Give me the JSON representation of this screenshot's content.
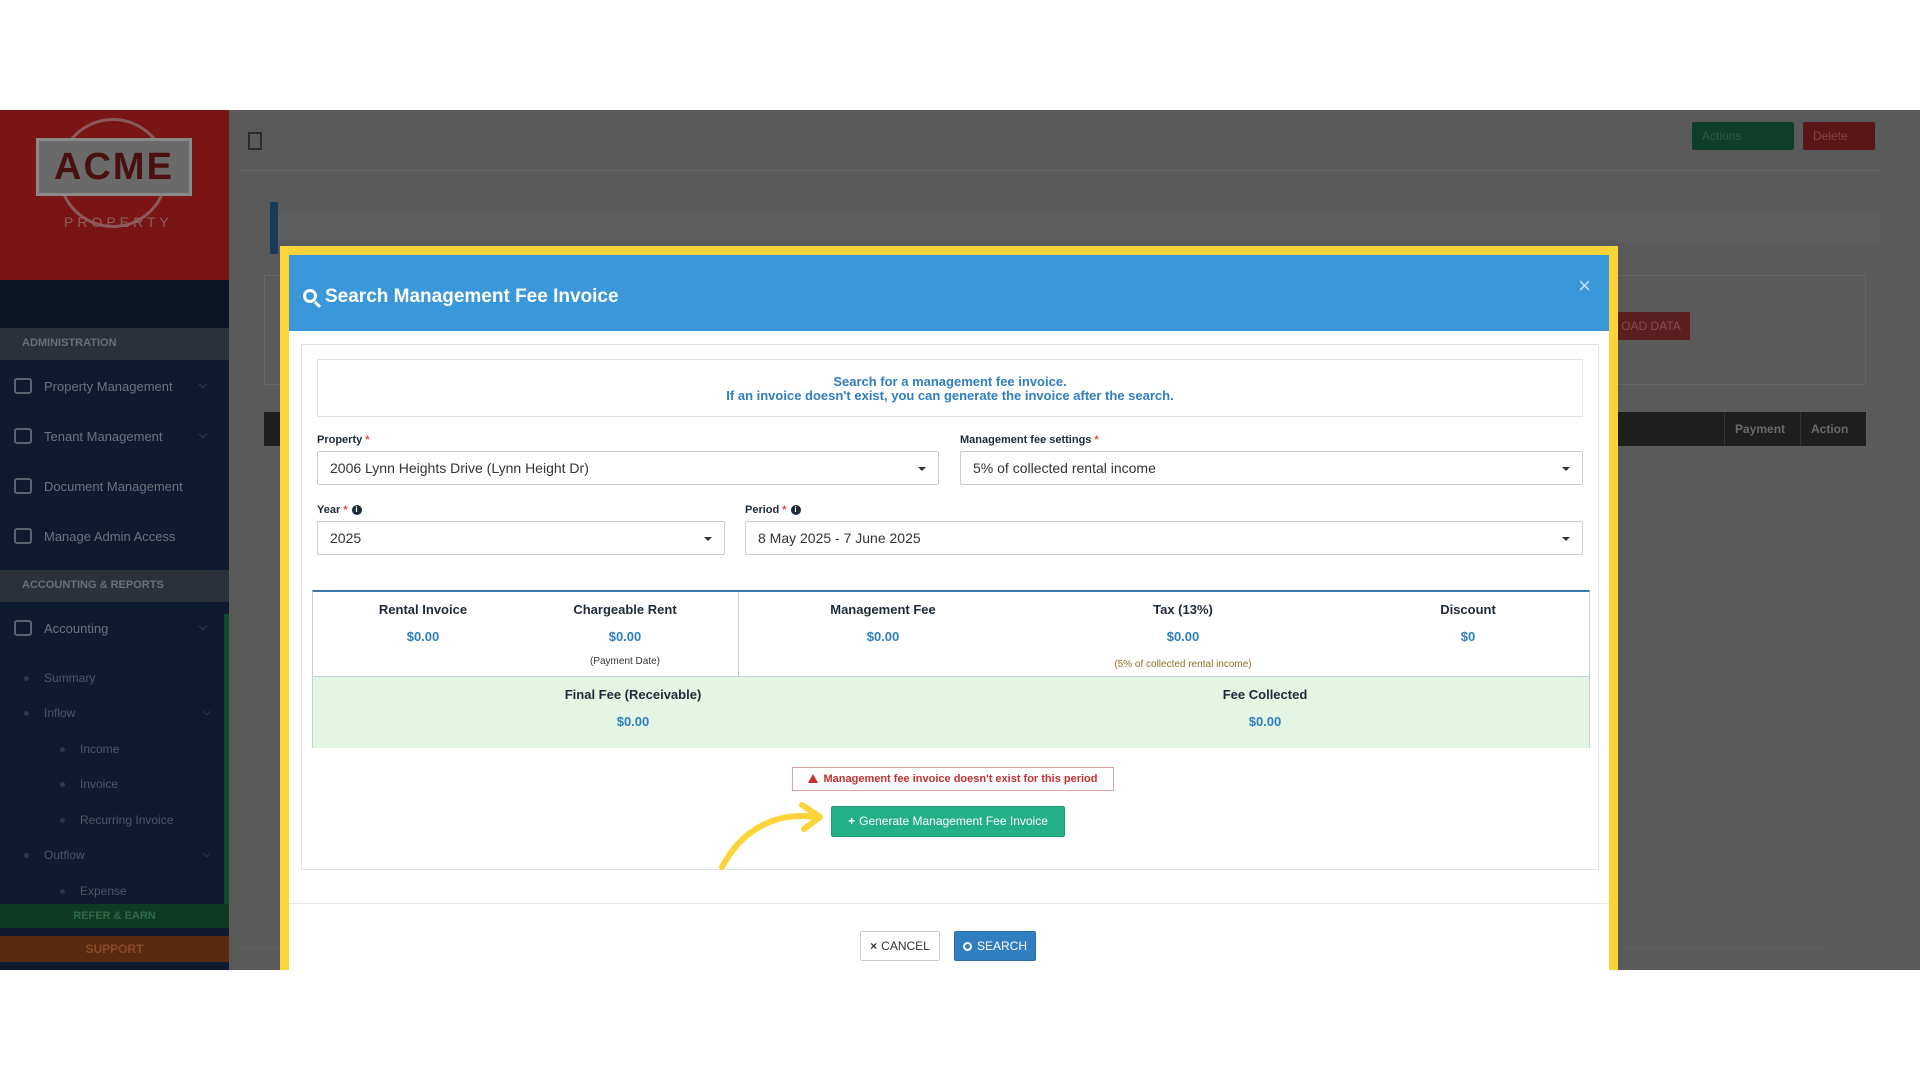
{
  "logo": {
    "brand": "ACME",
    "sub": "PROPERTY"
  },
  "sidebar": {
    "sections": [
      "ADMINISTRATION",
      "ACCOUNTING & REPORTS"
    ],
    "admin_items": [
      {
        "label": "Property Management"
      },
      {
        "label": "Tenant Management"
      },
      {
        "label": "Document Management"
      },
      {
        "label": "Manage Admin Access"
      }
    ],
    "accounting": {
      "label": "Accounting"
    },
    "sub_items": {
      "summary": "Summary",
      "inflow": "Inflow",
      "income": "Income",
      "invoice": "Invoice",
      "recurring": "Recurring Invoice",
      "outflow": "Outflow",
      "expense": "Expense"
    },
    "refer": "REFER & EARN",
    "support": "SUPPORT"
  },
  "background": {
    "actions_label": "Actions",
    "delete_label": "Delete",
    "load_label": "OAD DATA",
    "table_headers": {
      "payment": "Payment",
      "action": "Action"
    }
  },
  "modal": {
    "title": "Search Management Fee Invoice",
    "info_line1": "Search for a management fee invoice.",
    "info_line2": "If an invoice doesn't exist, you can generate the invoice after the search.",
    "fields": {
      "property": {
        "label": "Property",
        "value": "2006 Lynn Heights Drive (Lynn Height Dr)"
      },
      "fee_settings": {
        "label": "Management fee settings",
        "value": "5% of collected rental income"
      },
      "year": {
        "label": "Year",
        "value": "2025"
      },
      "period": {
        "label": "Period",
        "value": "8 May 2025 - 7 June 2025"
      }
    },
    "summary": {
      "rental_invoice": {
        "label": "Rental Invoice",
        "value": "$0.00"
      },
      "chargeable_rent": {
        "label": "Chargeable Rent",
        "value": "$0.00",
        "note": "(Payment Date)"
      },
      "management_fee": {
        "label": "Management Fee",
        "value": "$0.00"
      },
      "tax": {
        "label": "Tax (13%)",
        "value": "$0.00"
      },
      "discount": {
        "label": "Discount",
        "value": "$0"
      },
      "fee_note": "(5% of collected rental income)",
      "final_fee": {
        "label": "Final Fee (Receivable)",
        "value": "$0.00"
      },
      "fee_collected": {
        "label": "Fee Collected",
        "value": "$0.00"
      }
    },
    "alert": "Management fee invoice doesn't exist for this period",
    "generate_label": "Generate Management Fee Invoice",
    "cancel_label": "CANCEL",
    "search_label": "SEARCH"
  },
  "colors": {
    "modal_header": "#3a98da",
    "highlight_frame": "#fcd43a",
    "generate_button": "#23b088",
    "search_button": "#2f7ec0",
    "summary_green": "#e4f5e4"
  }
}
